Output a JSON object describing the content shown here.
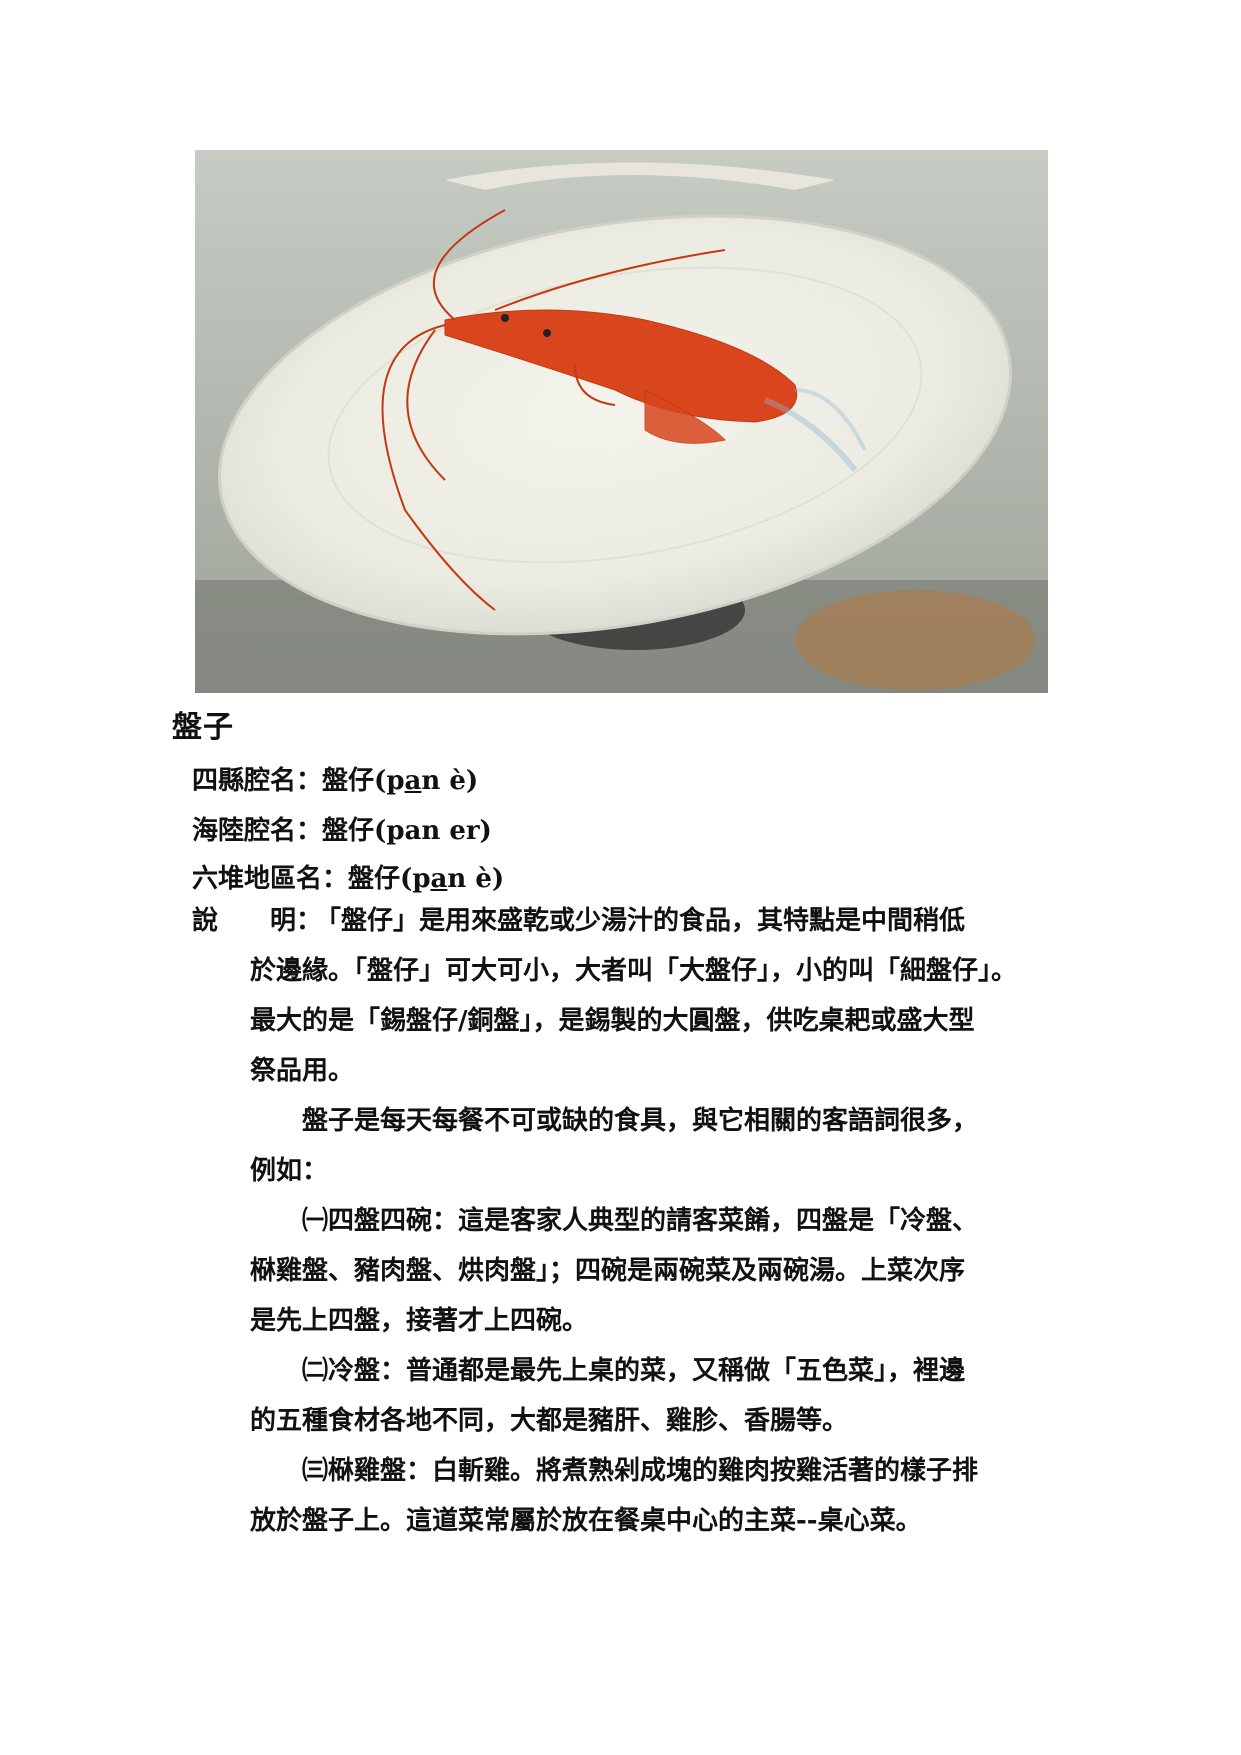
{
  "figure": {
    "alt": ""
  },
  "title": "盤子",
  "names": [
    {
      "label": "四縣腔名：",
      "word": "盤仔",
      "pron_pre": "(p",
      "pron_u": "a",
      "pron_post": "n è)"
    },
    {
      "label": "海陸腔名：",
      "word": "盤仔",
      "pron_pre": "(pan er)",
      "pron_u": "",
      "pron_post": ""
    },
    {
      "label": "六堆地區名：",
      "word": "盤仔",
      "pron_pre": "(p",
      "pron_u": "a",
      "pron_post": "n è)"
    }
  ],
  "description": {
    "label": "說　　明：",
    "line1": "「盤仔」是用來盛乾或少湯汁的食品，其特點是中間稍低",
    "line2": "於邊緣。「盤仔」可大可小，大者叫「大盤仔」，小的叫「細盤仔」。",
    "line3": "最大的是「錫盤仔/銅盤」，是錫製的大圓盤，供吃桌耙或盛大型",
    "line4": "祭品用。",
    "line5": "　　盤子是每天每餐不可或缺的食具，與它相關的客語詞很多，",
    "line6": "例如：",
    "item1_a": "　　㈠四盤四碗：這是客家人典型的請客菜餚，四盤是「冷盤、",
    "item1_b": "㮟雞盤、豬肉盤、烘肉盤」；四碗是兩碗菜及兩碗湯。上菜次序",
    "item1_c": "是先上四盤，接著才上四碗。",
    "item2_a": "　　㈡冷盤：普通都是最先上桌的菜，又稱做「五色菜」，裡邊",
    "item2_b": "的五種食材各地不同，大都是豬肝、雞胗、香腸等。",
    "item3_a": "　　㈢㮟雞盤：白斬雞。將煮熟剁成塊的雞肉按雞活著的樣子排",
    "item3_b": "放於盤子上。這道菜常屬於放在餐桌中心的主菜--桌心菜。"
  }
}
